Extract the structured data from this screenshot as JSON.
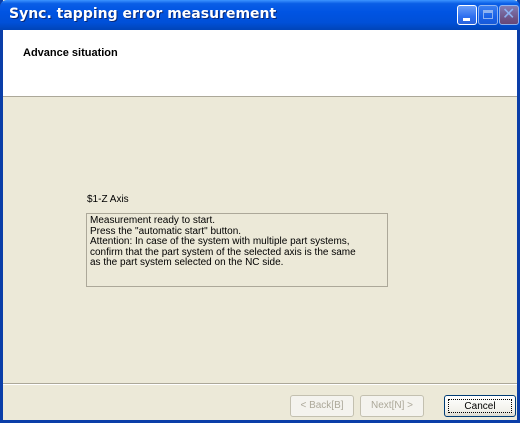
{
  "window": {
    "title": "Sync. tapping error measurement"
  },
  "header": {
    "title": "Advance situation"
  },
  "main": {
    "axis_label": "$1-Z Axis",
    "message_lines": [
      "Measurement ready to start.",
      "Press the \"automatic start\" button.",
      "Attention: In case of the system with multiple part systems,",
      "confirm that the part system of the selected axis is the same",
      "as the part system selected on the NC side."
    ]
  },
  "footer": {
    "back_label": "< Back[B]",
    "next_label": "Next[N] >",
    "cancel_label": "Cancel"
  },
  "colors": {
    "titlebar": "#0054e3",
    "dialog_bg": "#ece9d8",
    "disabled_text": "#aca899"
  },
  "icons": {
    "minimize": "minimize-icon",
    "maximize": "maximize-icon",
    "close": "close-icon"
  }
}
